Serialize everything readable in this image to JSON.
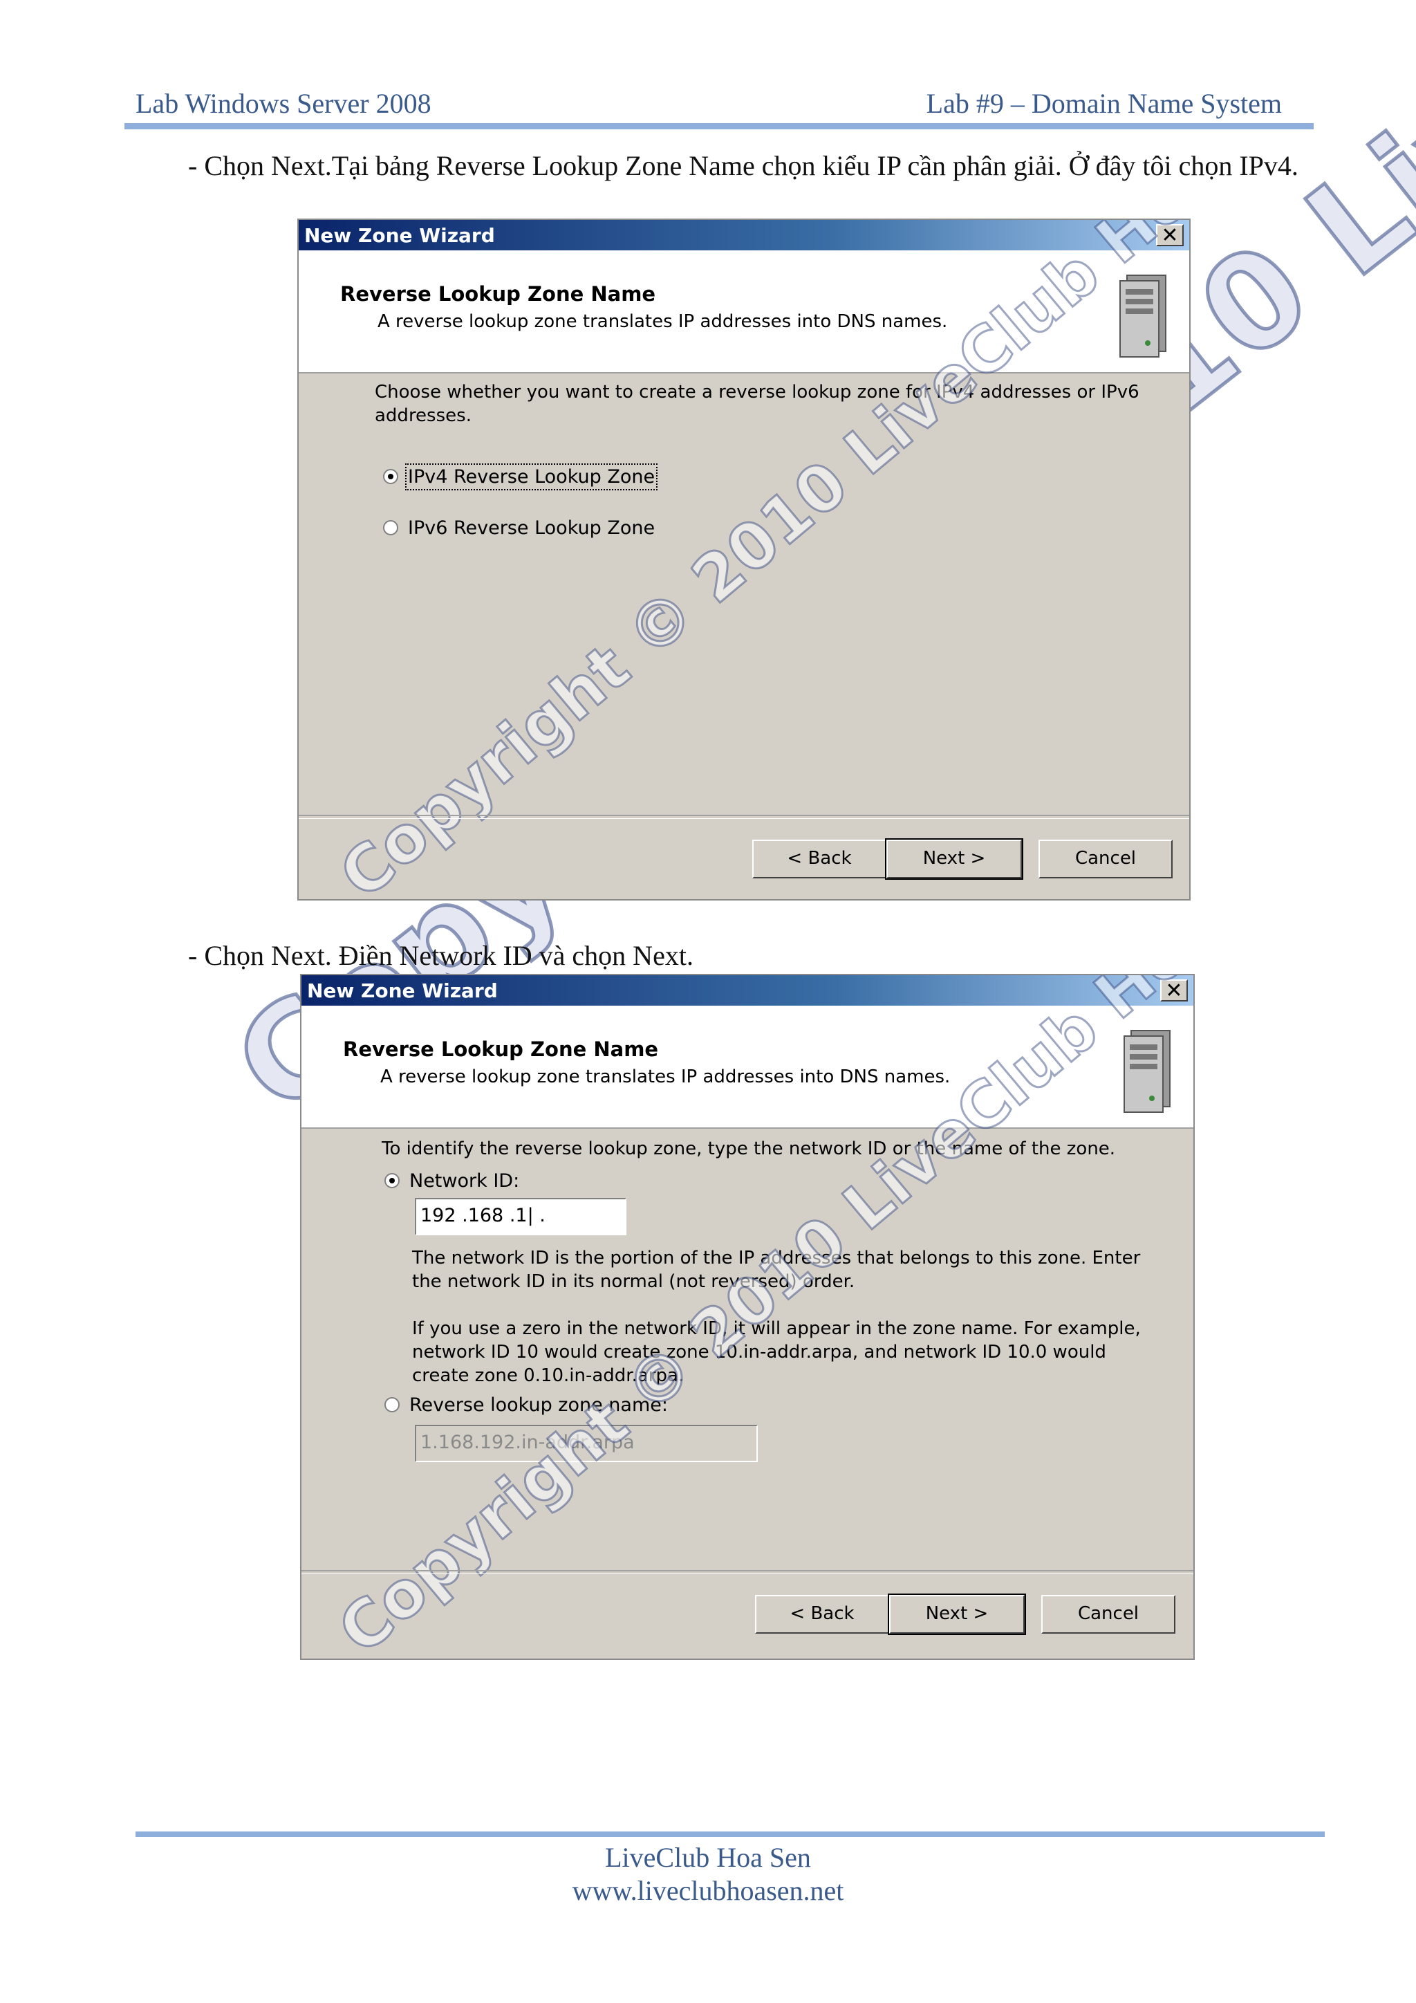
{
  "header": {
    "left": "Lab Windows Server 2008",
    "right": "Lab #9 – Domain Name System"
  },
  "paragraphs": {
    "p1": "- Chọn Next.Tại bảng Reverse Lookup Zone Name chọn kiểu IP cần phân giải. Ở đây tôi chọn IPv4.",
    "p2": "- Chọn Next. Điền Network ID và chọn Next."
  },
  "dialog1": {
    "title": "New Zone Wizard",
    "close": "✕",
    "heading": "Reverse Lookup Zone Name",
    "subheading": "A reverse lookup zone translates IP addresses into DNS names.",
    "prompt": "Choose whether you want to create a reverse lookup zone for IPv4 addresses or IPv6 addresses.",
    "option_ipv4": "IPv4 Reverse Lookup Zone",
    "option_ipv6": "IPv6 Reverse Lookup Zone",
    "back": "< Back",
    "next": "Next >",
    "cancel": "Cancel",
    "watermark": "Copyright © 2010 LiveClub Hoa Sen"
  },
  "dialog2": {
    "title": "New Zone Wizard",
    "close": "✕",
    "heading": "Reverse Lookup Zone Name",
    "subheading": "A reverse lookup zone translates IP addresses into DNS names.",
    "prompt": "To identify the reverse lookup zone, type the network ID or the name of the zone.",
    "network_id_label": "Network ID:",
    "network_id_value": "192  .168  .1|      .",
    "info1": "The network ID is the portion of the IP addresses that belongs to this zone. Enter the network ID in its normal (not reversed) order.",
    "info2": "If you use a zero in the network ID, it will appear in the zone name. For example, network ID 10 would create zone 10.in-addr.arpa, and network ID 10.0 would create zone 0.10.in-addr.arpa.",
    "zone_name_label": "Reverse lookup zone name:",
    "zone_name_value": "1.168.192.in-addr.arpa",
    "back": "< Back",
    "next": "Next >",
    "cancel": "Cancel",
    "watermark": "Copyright © 2010 LiveClub Hoa Sen"
  },
  "page_watermark": "Copyright © 2010 LiveClub Hoa Sen",
  "footer": {
    "line1": "LiveClub Hoa Sen",
    "line2": "www.liveclubhoasen.net"
  }
}
